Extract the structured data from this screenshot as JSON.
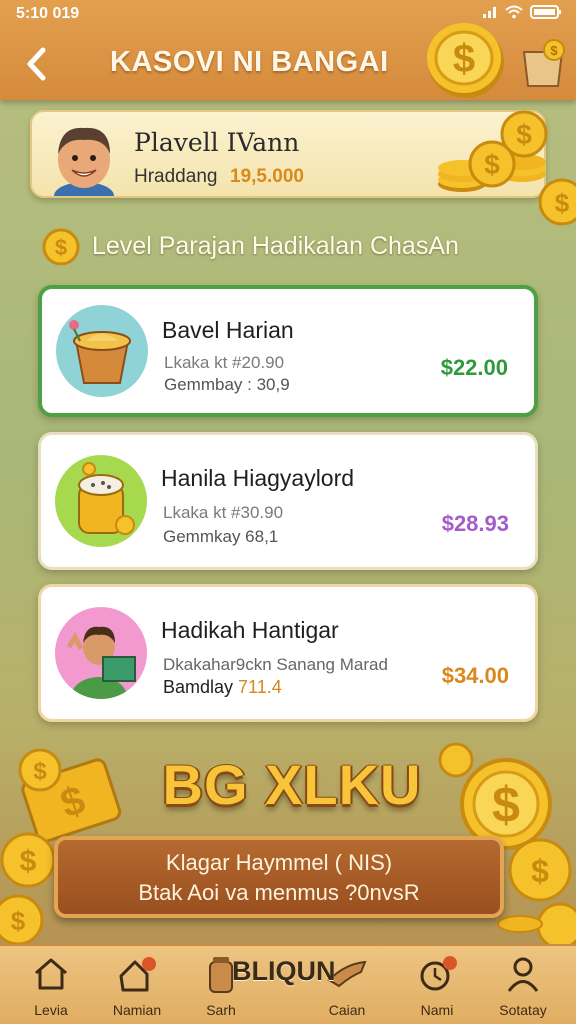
{
  "status_bar": {
    "time": "5:10 019"
  },
  "header": {
    "title": "KASOVI NI BANGAI"
  },
  "profile": {
    "name": "Plavell IVann",
    "balance_label": "Hraddang",
    "balance_value": "19,5.000"
  },
  "section": {
    "title": "Level Parajan Hadikalan ChasAn"
  },
  "levels": [
    {
      "name": "Bavel Harian",
      "detail_1": "Lkaka kt #20.90",
      "detail_2": "Gemmbay : 30,9",
      "price": "$22.00",
      "price_color": "#2f9a3c"
    },
    {
      "name": "Hanila Hiagyaylord",
      "detail_1": "Lkaka kt #30.90",
      "detail_2": "Gemmkay  68,1",
      "price": "$28.93",
      "price_color": "#a45cc9"
    },
    {
      "name": "Hadikah Hantigar",
      "detail_1": "Dkakahar9ckn Sanang Marad",
      "detail_2": "Bamdlay",
      "detail_2_value": "711.4",
      "price": "$34.00",
      "price_color": "#d9881c"
    }
  ],
  "bonus": {
    "title": "BG XLKU",
    "line_1": "Klagar Haymmel ( NIS)",
    "line_2": "Btak Aoi va menmus ?0nvsR"
  },
  "nav": {
    "center_label": "BLIQUN",
    "items": [
      {
        "label": "Levia",
        "icon": "home-icon"
      },
      {
        "label": "Namian",
        "icon": "house-badge-icon"
      },
      {
        "label": "Sarh",
        "icon": "jar-icon"
      },
      {
        "label": "Caian",
        "icon": "hand-icon"
      },
      {
        "label": "Nami",
        "icon": "alarm-icon"
      },
      {
        "label": "Sotatay",
        "icon": "user-icon"
      }
    ]
  },
  "colors": {
    "header": "#d58a3c",
    "accent_green": "#4ea045",
    "coin": "#f2b51f"
  }
}
